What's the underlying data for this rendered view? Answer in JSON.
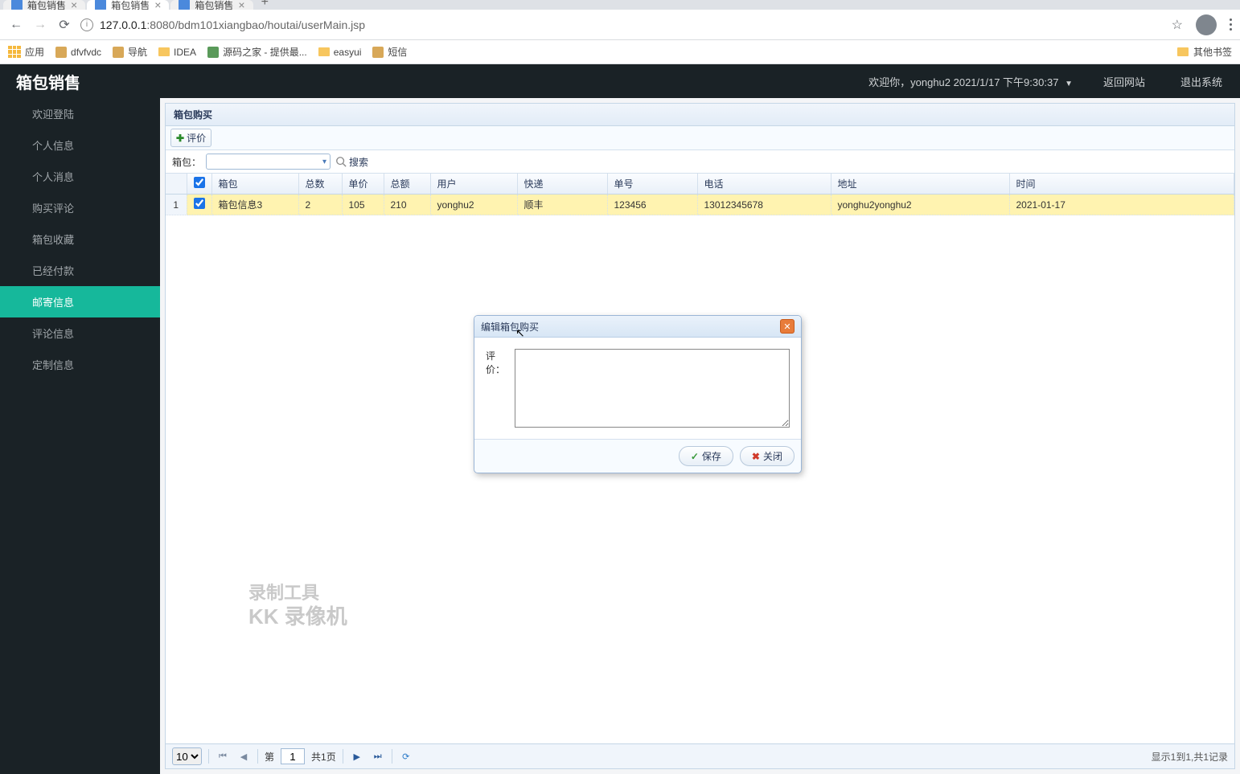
{
  "browser": {
    "tabs": [
      {
        "title": "箱包销售"
      },
      {
        "title": "箱包销售"
      },
      {
        "title": "箱包销售"
      }
    ],
    "url_host": "127.0.0.1",
    "url_port": ":8080",
    "url_path": "/bdm101xiangbao/houtai/userMain.jsp",
    "bookmarks": {
      "apps": "应用",
      "items": [
        "dfvfvdc",
        "导航",
        "IDEA",
        "源码之家 - 提供最...",
        "easyui",
        "短信"
      ],
      "other": "其他书签"
    }
  },
  "header": {
    "title": "箱包销售",
    "welcome": "欢迎你，yonghu2  2021/1/17 下午9:30:37",
    "back_site": "返回网站",
    "logout": "退出系统"
  },
  "sidebar": {
    "items": [
      "欢迎登陆",
      "个人信息",
      "个人消息",
      "购买评论",
      "箱包收藏",
      "已经付款",
      "邮寄信息",
      "评论信息",
      "定制信息"
    ],
    "active_index": 6
  },
  "panel": {
    "title": "箱包购买",
    "eval_btn": "评价",
    "search_label": "箱包：",
    "search_btn": "搜索"
  },
  "table": {
    "columns": [
      "箱包",
      "总数",
      "单价",
      "总额",
      "用户",
      "快递",
      "单号",
      "电话",
      "地址",
      "时间"
    ],
    "rows": [
      {
        "num": "1",
        "cells": [
          "箱包信息3",
          "2",
          "105",
          "210",
          "yonghu2",
          "顺丰",
          "123456",
          "13012345678",
          "yonghu2yonghu2",
          "2021-01-17"
        ],
        "checked": true
      }
    ]
  },
  "pager": {
    "page_size": "10",
    "page_label_pre": "第",
    "page_num": "1",
    "page_label_post": "共1页",
    "info": "显示1到1,共1记录"
  },
  "dialog": {
    "title": "编辑箱包购买",
    "field_label": "评价：",
    "save": "保存",
    "close": "关闭"
  },
  "watermark": {
    "line1": "录制工具",
    "line2": "KK 录像机"
  }
}
